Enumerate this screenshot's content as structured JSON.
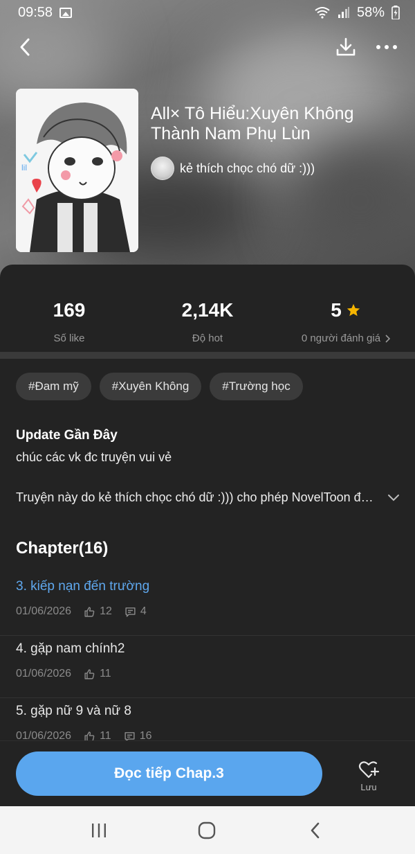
{
  "status_bar": {
    "time": "09:58",
    "battery": "58%"
  },
  "book": {
    "title": "All× Tô Hiểu:Xuyên Không Thành Nam Phụ Lùn",
    "author": "kẻ thích chọc chó dữ :)))"
  },
  "stats": {
    "likes": {
      "value": "169",
      "label": "Số like"
    },
    "hot": {
      "value": "2,14K",
      "label": "Độ hot"
    },
    "rating": {
      "value": "5",
      "label": "0 người đánh giá"
    }
  },
  "tags": [
    "#Đam mỹ",
    "#Xuyên Không",
    "#Trường học"
  ],
  "update": {
    "title": "Update Gần Đây",
    "text": "chúc các vk đc truyện vui vẻ"
  },
  "description": "Truyện này do kẻ thích chọc chó dữ :))) cho phép NovelToon độc quyền phát hành",
  "chapter_heading": "Chapter(16)",
  "chapters": [
    {
      "title": "3. kiếp nạn đến trường",
      "date": "01/06/2026",
      "likes": "12",
      "comments": "4"
    },
    {
      "title": "4. gặp nam chính2",
      "date": "01/06/2026",
      "likes": "11",
      "comments": ""
    },
    {
      "title": "5. gặp nữ 9 và nữ 8",
      "date": "01/06/2026",
      "likes": "11",
      "comments": "16"
    }
  ],
  "actions": {
    "read_label": "Đọc tiếp Chap.3",
    "save_label": "Lưu"
  },
  "colors": {
    "accent": "#5aa6ee",
    "star": "#f5b400",
    "background": "#232323"
  }
}
